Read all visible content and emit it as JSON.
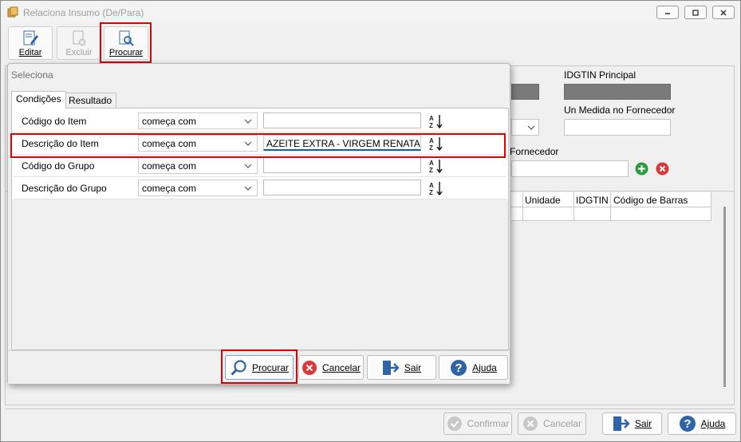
{
  "window": {
    "title": "Relaciona Insumo (De/Para)"
  },
  "toolbar": {
    "editar": "Editar",
    "excluir": "Excluir",
    "procurar": "Procurar"
  },
  "main": {
    "idgtin_label": "IDGTIN Principal",
    "unmedida_label": "Un Medida no Fornecedor",
    "fornecedor_label": "Fornecedor",
    "grid_headers": [
      "Unidade",
      "IDGTIN",
      "Código de Barras"
    ]
  },
  "footer": {
    "confirmar": "Confirmar",
    "cancelar": "Cancelar",
    "sair": "Sair",
    "ajuda": "Ajuda"
  },
  "dialog": {
    "title": "Seleciona",
    "tabs": [
      "Condições",
      "Resultado"
    ],
    "rows": [
      {
        "label": "Código do Item",
        "condition": "começa com",
        "value": ""
      },
      {
        "label": "Descrição do Item",
        "condition": "começa com",
        "value": "AZEITE EXTRA - VIRGEM RENATA VIDRO"
      },
      {
        "label": "Código do Grupo",
        "condition": "começa com",
        "value": ""
      },
      {
        "label": "Descrição do Grupo",
        "condition": "começa com",
        "value": ""
      }
    ],
    "buttons": {
      "procurar": "Procurar",
      "cancelar": "Cancelar",
      "sair": "Sair",
      "ajuda": "Ajuda"
    }
  },
  "colors": {
    "highlight": "#e00000",
    "accent": "#0063b1",
    "add": "#2e9b3e",
    "remove": "#d83a3a"
  }
}
